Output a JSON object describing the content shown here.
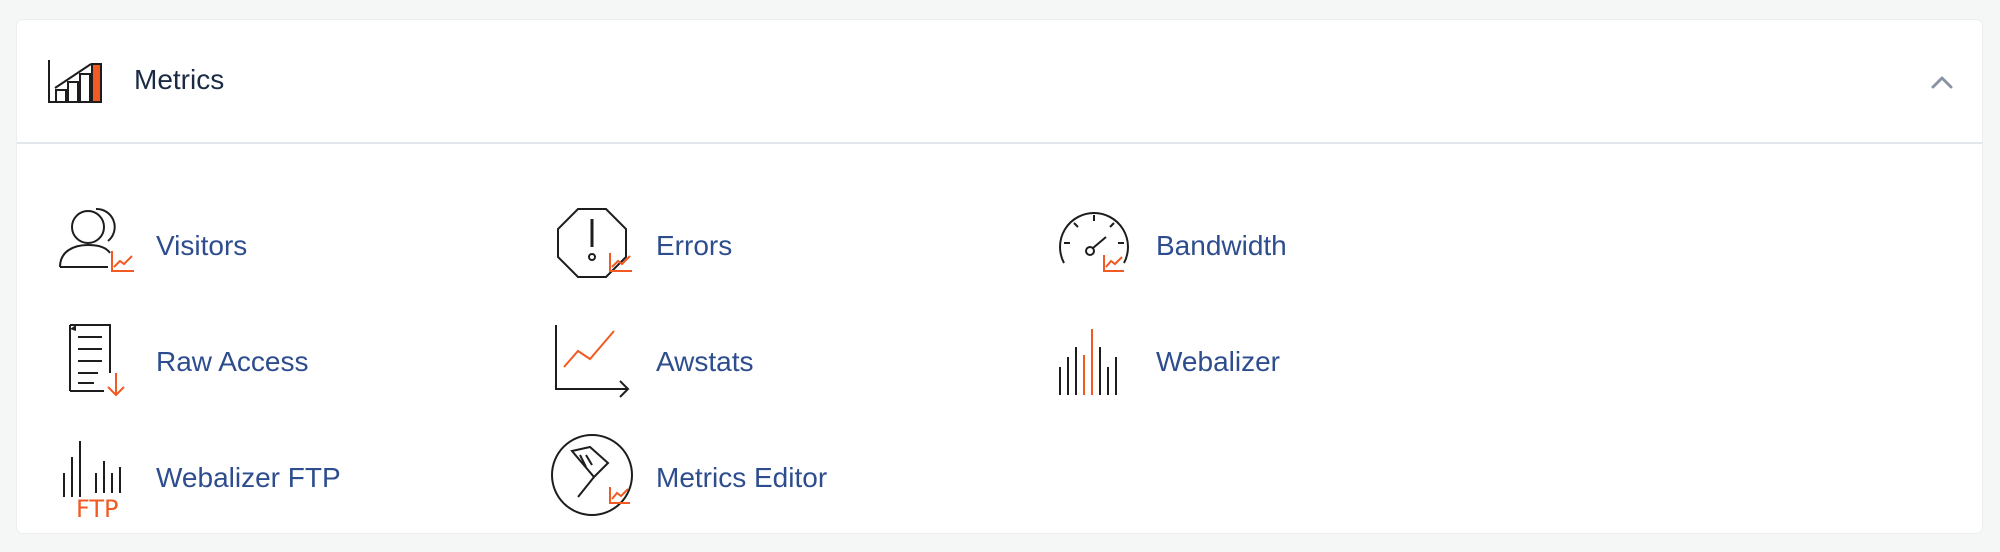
{
  "colors": {
    "accent": "#f15a22",
    "link": "#2d4d8e",
    "title": "#1b2a44",
    "icon": "#1d1d1d"
  },
  "panel": {
    "title": "Metrics",
    "header_icon": "metrics-bar-chart-icon",
    "toggle_icon": "chevron-up-icon"
  },
  "items": [
    {
      "label": "Visitors",
      "icon": "visitors-icon"
    },
    {
      "label": "Errors",
      "icon": "errors-icon"
    },
    {
      "label": "Bandwidth",
      "icon": "bandwidth-gauge-icon"
    },
    {
      "label": "Raw Access",
      "icon": "raw-access-log-icon"
    },
    {
      "label": "Awstats",
      "icon": "awstats-graph-icon"
    },
    {
      "label": "Webalizer",
      "icon": "webalizer-bars-icon"
    },
    {
      "label": "Webalizer FTP",
      "icon": "webalizer-ftp-icon"
    },
    {
      "label": "Metrics Editor",
      "icon": "metrics-editor-pen-icon"
    }
  ],
  "ftp_text": "FTP"
}
